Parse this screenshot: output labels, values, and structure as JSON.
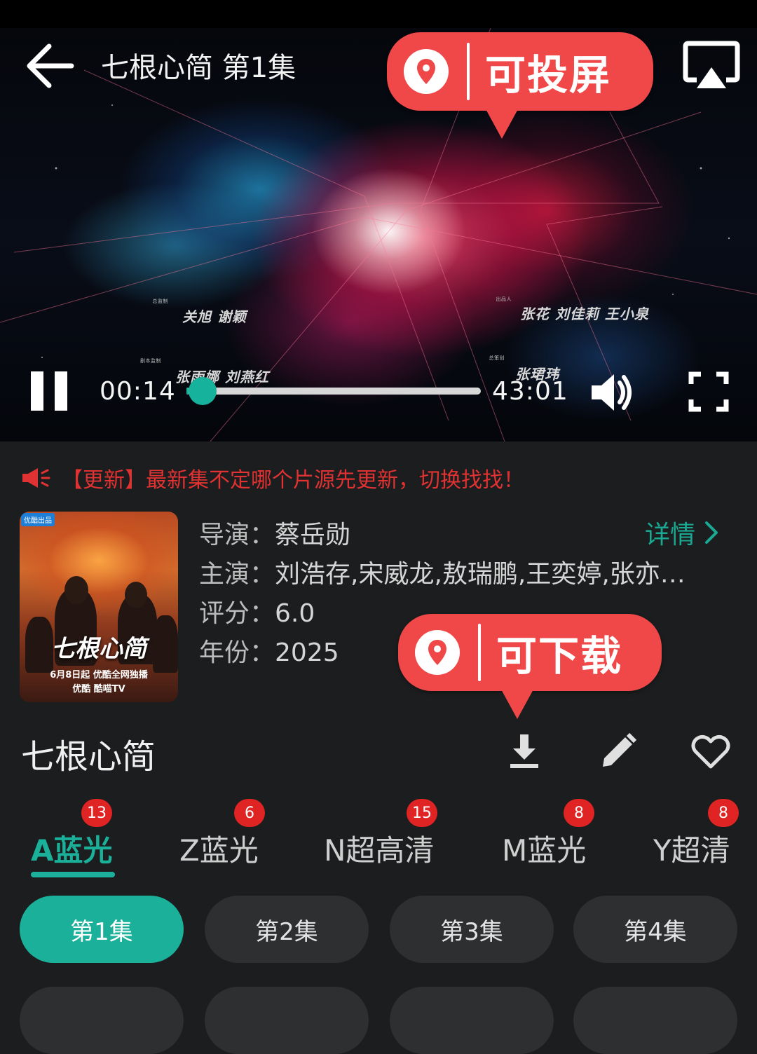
{
  "player": {
    "title": "七根心简 第1集",
    "current_time": "00:14",
    "duration": "43:01",
    "progress_fraction": 0.006,
    "accent_color": "#1ab09a",
    "credits": {
      "left_top_names": "关旭 谢颖",
      "left_bottom_names": "张雨娜 刘燕红",
      "right_top_names": "张花 刘佳莉 王小泉",
      "right_bottom_names": "张珺玮",
      "left_top_role": "总监制",
      "left_bottom_role": "剧本监制",
      "right_top_role": "出品人",
      "right_bottom_role": "总策划"
    }
  },
  "callouts": {
    "cast": "可投屏",
    "download": "可下载",
    "color": "#f04848"
  },
  "notice": {
    "text": "【更新】最新集不定哪个片源先更新，切换找找！",
    "color": "#e03232"
  },
  "poster": {
    "badge": "优酷出品",
    "title": "七根心简",
    "line1": "6月8日起 优酷全网独播",
    "line2": "优酷  酷喵TV"
  },
  "info": {
    "director_label": "导演：",
    "director": "蔡岳勋",
    "cast_label": "主演：",
    "cast": "刘浩存,宋威龙,敖瑞鹏,王奕婷,张亦…",
    "rating_label": "评分：",
    "rating": "6.0",
    "year_label": "年份：",
    "year": "2025",
    "detail_link": "详情"
  },
  "show_title": "七根心简",
  "sources": [
    {
      "label": "A蓝光",
      "count": "13"
    },
    {
      "label": "Z蓝光",
      "count": "6"
    },
    {
      "label": "N超高清",
      "count": "15"
    },
    {
      "label": "M蓝光",
      "count": "8"
    },
    {
      "label": "Y超清",
      "count": "8"
    }
  ],
  "episodes": [
    "第1集",
    "第2集",
    "第3集",
    "第4集"
  ]
}
